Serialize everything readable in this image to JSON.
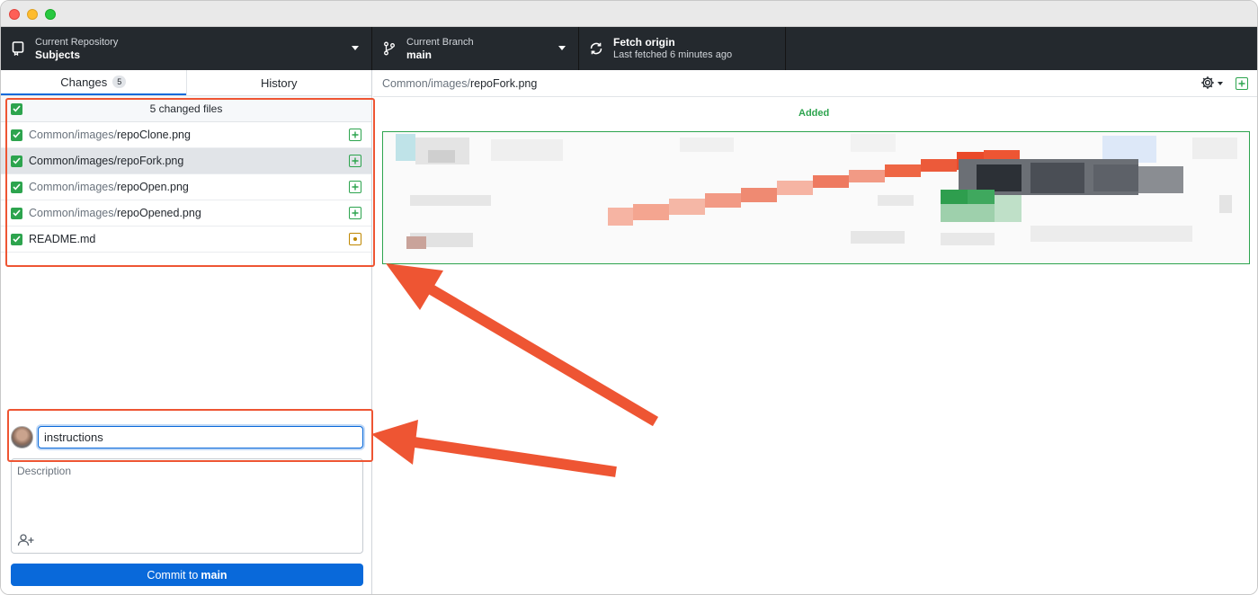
{
  "toolbar": {
    "repository": {
      "label": "Current Repository",
      "value": "Subjects"
    },
    "branch": {
      "label": "Current Branch",
      "value": "main"
    },
    "fetch": {
      "title": "Fetch origin",
      "subtitle": "Last fetched 6 minutes ago"
    }
  },
  "sidebar": {
    "tabs": [
      {
        "label": "Changes",
        "badge": "5",
        "active": true
      },
      {
        "label": "History",
        "active": false
      }
    ],
    "changes_header": "5 changed files",
    "files": [
      {
        "dir": "Common/images/",
        "name": "repoClone.png",
        "status": "added",
        "selected": false
      },
      {
        "dir": "Common/images/",
        "name": "repoFork.png",
        "status": "added",
        "selected": true
      },
      {
        "dir": "Common/images/",
        "name": "repoOpen.png",
        "status": "added",
        "selected": false
      },
      {
        "dir": "Common/images/",
        "name": "repoOpened.png",
        "status": "added",
        "selected": false
      },
      {
        "dir": "",
        "name": "README.md",
        "status": "modified",
        "selected": false
      }
    ]
  },
  "commit": {
    "summary_value": "instructions",
    "description_placeholder": "Description",
    "button_prefix": "Commit to",
    "button_branch": "main"
  },
  "diff": {
    "path_dir": "Common/images/",
    "path_file": "repoFork.png",
    "status_label": "Added"
  },
  "colors": {
    "accent_blue": "#0969da",
    "added_green": "#2da44e",
    "modified_yellow": "#bf8700",
    "annotation_red": "#ee5533",
    "toolbar_bg": "#24292e"
  }
}
